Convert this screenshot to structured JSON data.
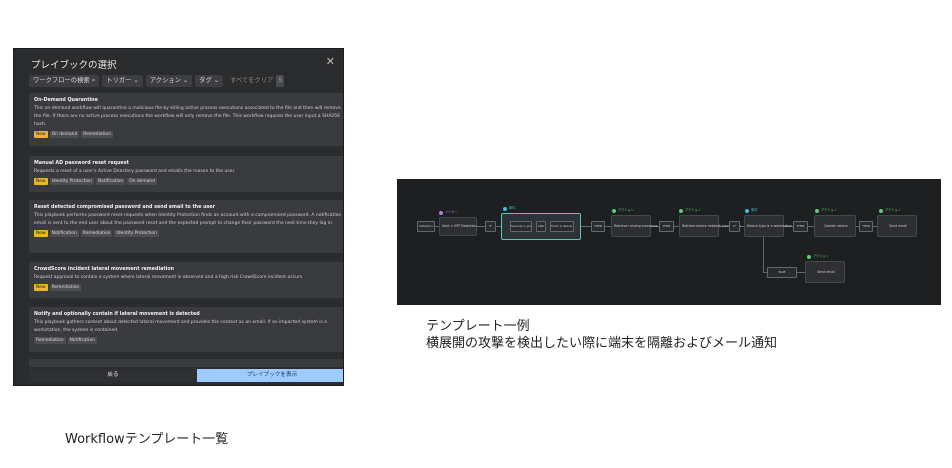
{
  "dialog": {
    "title": "プレイブックの選択",
    "close_icon": "close-icon",
    "filters": {
      "search": "ワークフローの検索",
      "trigger": "トリガー",
      "action": "アクション",
      "tag": "タグ",
      "clear": "すべてをクリア",
      "clear_count": "5"
    },
    "cards": [
      {
        "title": "On-Demand Quarantine",
        "description": "This on-demand workflow will quarantine a malicious file by killing active process executions associated to the file and then will remove the file. If there are no active process executions the workflow will only remove the file. This workflow requires the user input a SHA256 hash.",
        "tags": [
          "New",
          "On demand",
          "Remediation"
        ]
      },
      {
        "title": "Manual AD password reset request",
        "description": "Requests a reset of a user's Active Directory password and emails the reason to the user.",
        "tags": [
          "New",
          "Identity Protection",
          "Notification",
          "On demand"
        ]
      },
      {
        "title": "Reset detected compromised password and send email to the user",
        "description": "This playbook performs password reset requests when Identity Protection finds an account with a compromised password. A notification email is sent to the end user about the password reset and the expected prompt to change their password the next time they log in.",
        "tags": [
          "New",
          "Notification",
          "Remediation",
          "Identity Protection"
        ]
      },
      {
        "title": "CrowdScore incident lateral movement remediation",
        "description": "Request approval to contain a system where lateral movement is observed and a high risk CrowdScore incident occurs",
        "tags": [
          "New",
          "Remediation"
        ]
      },
      {
        "title": "Notify and optionally contain if lateral movement is detected",
        "description": "This playbook gathers context about detected lateral movement and provides the context as an email. If an impacted system is a workstation, the system is contained.",
        "tags": [
          "Remediation",
          "Notification"
        ]
      }
    ],
    "footer": {
      "back": "戻る",
      "show": "プレイブックを表示"
    }
  },
  "caption_left": "Workflowテンプレート一覧",
  "workflow": {
    "node_labels": {
      "start": "Detection",
      "trigger_header": "トリガー",
      "trigger_card": "Alert > EPP Detection",
      "cond1_header": "条件",
      "if1": "IF",
      "cond_a": "Severity is greater...",
      "and": "AND",
      "cond_b": "Tactic is lateral m...",
      "then1": "THEN",
      "act1_header": "アクション",
      "act1_card": "Retrieve running processes",
      "then2": "THEN",
      "act2_header": "アクション",
      "act2_card": "Retrieve device network connections",
      "if2": "IF",
      "cond2_header": "条件",
      "cond2_card": "Device type is a workstation",
      "then3": "THEN",
      "act3_header": "アクション",
      "act3_card": "Contain device",
      "then4": "THEN",
      "act4_header": "アクション",
      "act4_card": "Send email",
      "else": "ELSE",
      "act5_header": "アクション",
      "act5_card": "Send email"
    }
  },
  "caption_right": {
    "line1": "テンプレート一例",
    "line2": "横展開の攻撃を検出したい際に端末を隔離およびメール通知"
  }
}
